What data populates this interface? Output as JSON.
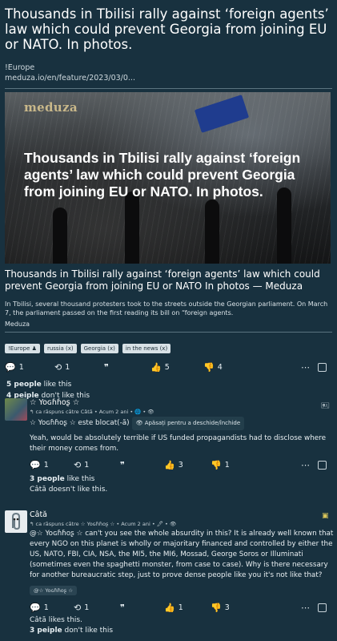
{
  "post": {
    "title": "Thousands in Tbilisi rally against ‘foreign agents’ law which could prevent Georgia from joining EU or NATO. In photos.",
    "community": "!Europe",
    "link": "meduza.io/en/feature/2023/03/0...",
    "card": {
      "brand": "meduza",
      "overlay_title": "Thousands in Tbilisi rally against ‘foreign agents’ law which could prevent Georgia from joining EU or NATO. In photos.",
      "title": "Thousands in Tbilisi rally against ‘foreign agents’ law which could prevent Georgia from joining EU or NATO In photos — Meduza",
      "description": "In Tbilisi, several thousand protesters took to the streets outside the Georgian parliament. On March 7, the parliament passed on the first reading its bill on “foreign agents.",
      "source": "Meduza"
    },
    "tags": [
      "!Europe ♟",
      "russia (x)",
      "Georgia (x)",
      "in the news (x)"
    ],
    "actions": {
      "comments": "1",
      "boosts": "1",
      "likes": "5",
      "dislikes": "4"
    },
    "likes_line": {
      "count": "5 people",
      "text": "like this"
    },
    "dislikes_line": {
      "count": "4 peiple",
      "text": "don't like this"
    }
  },
  "comments": [
    {
      "author": "☆ Yoɢɦɦᴏʂ ☆",
      "sub": "↰ ca răspuns către Câtă • Acum 2 ani • 🌐 • 👁",
      "blocked_text": "☆ Yoɢɦɦᴏʂ ☆ este blocat(-ă)",
      "toggle_label": "👁 Apăsați pentru a deschide/închide",
      "body": "Yeah, would be absolutely terrible if US funded propagandists had to disclose where their money comes from.",
      "actions": {
        "comments": "1",
        "boosts": "1",
        "likes": "3",
        "dislikes": "1"
      },
      "likes_line": {
        "count": "3 people",
        "text": "like this"
      },
      "dislikes_line": "Câtă doesn't like this."
    },
    {
      "author": "Câtă",
      "sub": "↰ ca răspuns către ☆ Yoɢɦɦᴏʂ ☆ • Acum 2 ani • 🖊 • 👁",
      "body": "@☆ Yoɢɦɦᴏʂ ☆ can't you see the whole absurdity in this? It is already well known that every NGO on this planet is wholly or majoritary financed and controlled by either the US, NATO, FBI, CIA, NSA, the MI5, the MI6, Mossad, George Soros or Illuminati (sometimes even the spaghetti monster, from case to case). Why is there necessary for another bureaucratic step, just to prove dense people like you it's not like that?",
      "mention_tag": "@☆ Yoɢɦɦᴏʂ ☆",
      "actions": {
        "comments": "1",
        "boosts": "1",
        "likes": "1",
        "dislikes": "3"
      },
      "likes_line": "Câtă likes this.",
      "dislikes_line": {
        "count": "3 peiple",
        "text": "don't like this"
      }
    }
  ],
  "colors": {
    "background": "#18313f",
    "accent": "#4aa8e6"
  }
}
